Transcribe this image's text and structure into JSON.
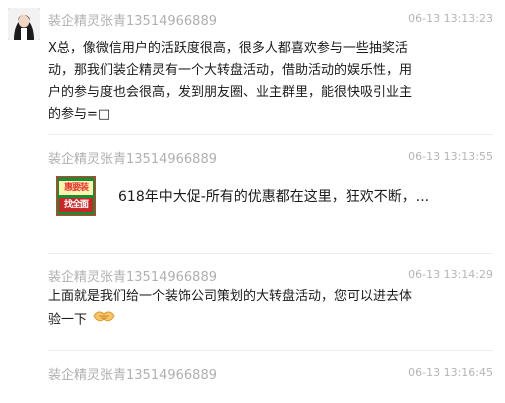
{
  "messages": [
    {
      "sender": "装企精灵张青13514966889",
      "time": "06-13 13:13:23",
      "lines": [
        "X总，像微信用户的活跃度很高，很多人都喜欢参与一些抽奖活",
        "动，那我们装企精灵有一个大转盘活动，借助活动的娱乐性，用",
        "户的参与度也会很高，发到朋友圈、业主群里，能很快吸引业主",
        "的参与=□"
      ]
    },
    {
      "sender": "装企精灵张青13514966889",
      "time": "06-13 13:13:55",
      "link_title": "618年中大促-所有的优惠都在这里，狂欢不断，...",
      "thumb_text": [
        "惠要装",
        "找全面"
      ]
    },
    {
      "sender": "装企精灵张青13514966889",
      "time": "06-13 13:14:29",
      "lines": [
        "上面就是我们给一个装饰公司策划的大转盘活动，您可以进去体",
        "验一下"
      ],
      "emoji": "handshake-icon"
    },
    {
      "sender": "装企精灵张青13514966889",
      "time": "06-13 13:16:45"
    }
  ],
  "colors": {
    "sender": "#b0b0b0",
    "time": "#b5b5b5",
    "text": "#1a1a1a",
    "separator": "#ececec",
    "thumb_bg": "#1f8a34",
    "thumb_accent": "#e53935"
  }
}
